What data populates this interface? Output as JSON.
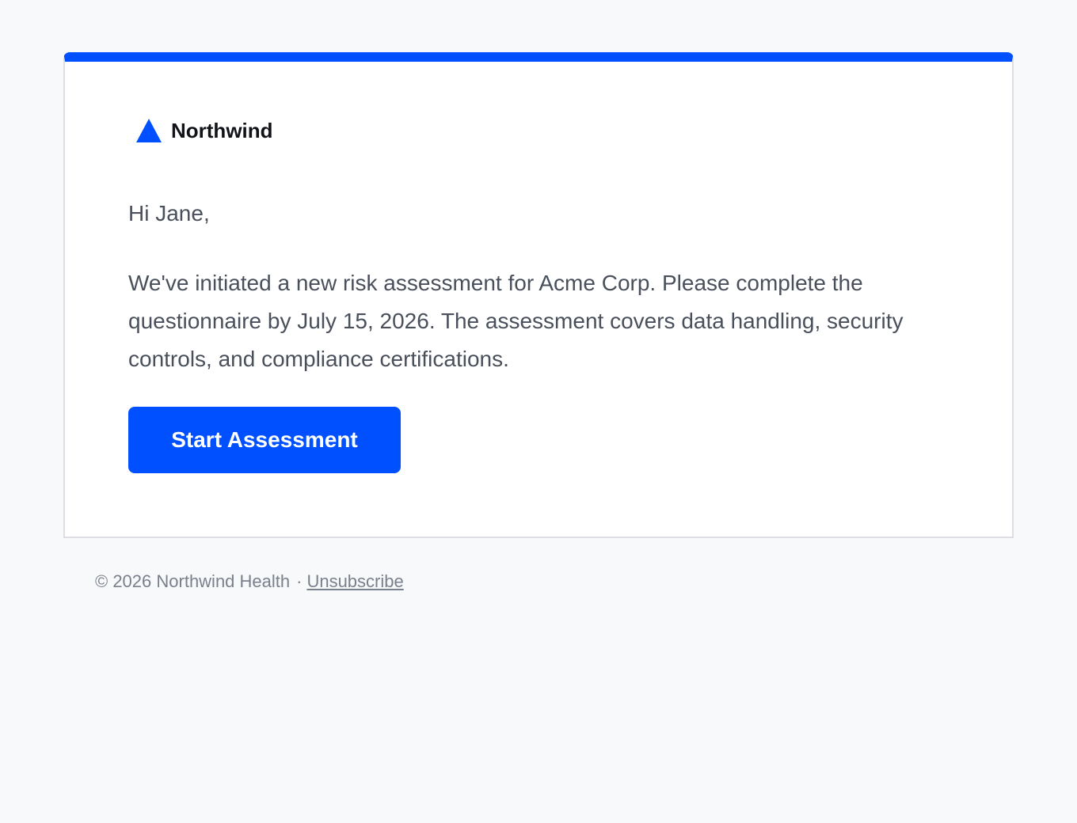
{
  "brand": {
    "name": "Northwind",
    "logo_icon": "triangle-logo-icon",
    "accent_color": "#0050ff"
  },
  "email": {
    "greeting": "Hi Jane,",
    "message": "We've initiated a new risk assessment for Acme Corp. Please complete the questionnaire by July 15, 2026. The assessment covers data handling, security controls, and compliance certifications.",
    "cta_label": "Start Assessment"
  },
  "footer": {
    "copyright": "© 2026 Northwind Health",
    "separator": "·",
    "unsubscribe_label": "Unsubscribe"
  }
}
